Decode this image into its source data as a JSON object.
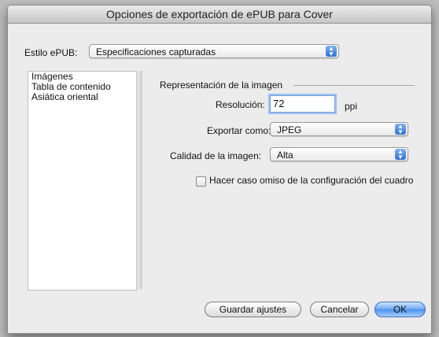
{
  "window": {
    "title": "Opciones de exportación de ePUB para Cover"
  },
  "estilo": {
    "label": "Estilo ePUB:",
    "value": "Especificaciones capturadas"
  },
  "sidebar": {
    "items": [
      {
        "label": "Imágenes"
      },
      {
        "label": "Tabla de contenido"
      },
      {
        "label": "Asiática oriental"
      }
    ]
  },
  "section": {
    "title": "Representación de la imagen"
  },
  "resolucion": {
    "label": "Resolución:",
    "value": "72",
    "unit": "ppi"
  },
  "exportar": {
    "label": "Exportar como:",
    "value": "JPEG"
  },
  "calidad": {
    "label": "Calidad de la imagen:",
    "value": "Alta"
  },
  "override": {
    "label": "Hacer caso omiso de la configuración del cuadro",
    "checked": false
  },
  "buttons": {
    "save": "Guardar ajustes",
    "cancel": "Cancelar",
    "ok": "OK"
  }
}
